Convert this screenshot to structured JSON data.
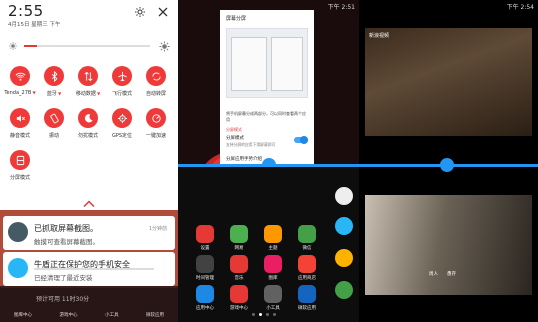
{
  "quick_settings": {
    "time": "2:55",
    "date": "4月15日 星期三 下午",
    "brightness_level_fraction": 0.1,
    "tiles": [
      {
        "label": "Tenda_27B",
        "icon": "wifi-icon",
        "caret": true
      },
      {
        "label": "蓝牙",
        "icon": "bluetooth-icon",
        "caret": true
      },
      {
        "label": "移动数据",
        "icon": "mobile-data-icon",
        "caret": true
      },
      {
        "label": "飞行模式",
        "icon": "airplane-icon",
        "caret": false
      },
      {
        "label": "自动转屏",
        "icon": "rotation-icon",
        "caret": false
      },
      {
        "label": "静音模式",
        "icon": "mute-icon",
        "caret": false
      },
      {
        "label": "振动",
        "icon": "vibrate-icon",
        "caret": false
      },
      {
        "label": "勿扰模式",
        "icon": "moon-icon",
        "caret": false
      },
      {
        "label": "GPS定位",
        "icon": "gps-icon",
        "caret": false
      },
      {
        "label": "一键加速",
        "icon": "boost-icon",
        "caret": false
      },
      {
        "label": "分屏模式",
        "icon": "split-screen-icon",
        "caret": false
      }
    ],
    "notifications": [
      {
        "title": "已抓取屏幕截图。",
        "subtitle": "触摸可查看屏幕截图。",
        "time": "1分钟前",
        "icon": "screenshot-icon"
      },
      {
        "title": "牛盾正在保护您的手机安全",
        "subtitle": "已经清理了最近安装",
        "time": "",
        "icon": "shield-icon"
      }
    ],
    "bottom_hint": "预计可用 11时30分",
    "bottom_labels": [
      "图库中心",
      "游戏中心",
      "小工具",
      "微软应用"
    ]
  },
  "split_panel": {
    "status_time": "下午 2:51",
    "dialog": {
      "title": "屏幕分屏",
      "description": "将手机屏幕分成两部分，可以同时查看两个应用",
      "section": "分屏模式",
      "toggle_label": "分屏模式",
      "toggle_sub": "支持分屏的应用下滑屏幕即可",
      "toggle_on": true,
      "more_label": "分屏应用手势介绍"
    },
    "apps_row1": [
      {
        "label": "设置",
        "color": "#e53935"
      },
      {
        "label": "网易",
        "color": "#4caf50"
      },
      {
        "label": "主题",
        "color": "#ff9800"
      },
      {
        "label": "微信",
        "color": "#43a047"
      }
    ],
    "apps_row2": [
      {
        "label": "时间管理",
        "color": "#424242"
      },
      {
        "label": "音乐",
        "color": "#e53935"
      },
      {
        "label": "图库",
        "color": "#e91e63"
      },
      {
        "label": "应用商店",
        "color": "#f44336"
      }
    ],
    "apps_row3": [
      {
        "label": "应用中心",
        "color": "#1e88e5"
      },
      {
        "label": "游戏中心",
        "color": "#e53935"
      },
      {
        "label": "小工具",
        "color": "#616161"
      },
      {
        "label": "微软应用",
        "color": "#1565c0"
      }
    ]
  },
  "video_panel": {
    "status_time": "下午 2:54",
    "video1_tag": "新浪视频",
    "video2_subtitle": "周人　　愚存"
  }
}
